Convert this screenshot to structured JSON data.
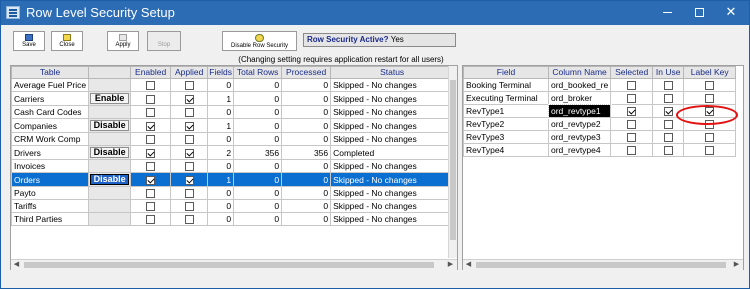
{
  "window": {
    "title": "Row Level Security Setup"
  },
  "toolbar": {
    "save_label": "Save",
    "close_label": "Close",
    "apply_label": "Apply",
    "stop_label": "Stop",
    "disable_label": "Disable Row Security"
  },
  "status": {
    "label": "Row Security Active?",
    "value": "Yes"
  },
  "note": "(Changing setting requires application restart for all users)",
  "left_table": {
    "headers": [
      "Table",
      "",
      "Enabled",
      "Applied",
      "Fields",
      "Total Rows",
      "Processed",
      "Status"
    ],
    "rows": [
      {
        "table": "Average Fuel Price",
        "button": "",
        "enabled": false,
        "applied": false,
        "fields": "0",
        "total_rows": "0",
        "processed": "0",
        "status": "Skipped - No changes"
      },
      {
        "table": "Carriers",
        "button": "Enable",
        "enabled": false,
        "applied": true,
        "fields": "1",
        "total_rows": "0",
        "processed": "0",
        "status": "Skipped - No changes"
      },
      {
        "table": "Cash Card Codes",
        "button": "",
        "enabled": false,
        "applied": false,
        "fields": "0",
        "total_rows": "0",
        "processed": "0",
        "status": "Skipped - No changes"
      },
      {
        "table": "Companies",
        "button": "Disable",
        "enabled": true,
        "applied": true,
        "fields": "1",
        "total_rows": "0",
        "processed": "0",
        "status": "Skipped - No changes"
      },
      {
        "table": "CRM Work Comp",
        "button": "",
        "enabled": false,
        "applied": false,
        "fields": "0",
        "total_rows": "0",
        "processed": "0",
        "status": "Skipped - No changes"
      },
      {
        "table": "Drivers",
        "button": "Disable",
        "enabled": true,
        "applied": true,
        "fields": "2",
        "total_rows": "356",
        "processed": "356",
        "status": "Completed"
      },
      {
        "table": "Invoices",
        "button": "",
        "enabled": false,
        "applied": false,
        "fields": "0",
        "total_rows": "0",
        "processed": "0",
        "status": "Skipped - No changes"
      },
      {
        "table": "Orders",
        "button": "Disable",
        "enabled": true,
        "applied": true,
        "fields": "1",
        "total_rows": "0",
        "processed": "0",
        "status": "Skipped - No changes",
        "selected": true
      },
      {
        "table": "Payto",
        "button": "",
        "enabled": false,
        "applied": false,
        "fields": "0",
        "total_rows": "0",
        "processed": "0",
        "status": "Skipped - No changes"
      },
      {
        "table": "Tariffs",
        "button": "",
        "enabled": false,
        "applied": false,
        "fields": "0",
        "total_rows": "0",
        "processed": "0",
        "status": "Skipped - No changes"
      },
      {
        "table": "Third Parties",
        "button": "",
        "enabled": false,
        "applied": false,
        "fields": "0",
        "total_rows": "0",
        "processed": "0",
        "status": "Skipped - No changes"
      }
    ]
  },
  "right_table": {
    "headers": [
      "Field",
      "Column Name",
      "Selected",
      "In Use",
      "Label Key"
    ],
    "rows": [
      {
        "field": "Booking Terminal",
        "column": "ord_booked_re",
        "selected": false,
        "in_use": false,
        "label_key": false
      },
      {
        "field": "Executing Terminal",
        "column": "ord_broker",
        "selected": false,
        "in_use": false,
        "label_key": false
      },
      {
        "field": "RevType1",
        "column": "ord_revtype1",
        "selected": true,
        "in_use": true,
        "label_key": true,
        "editing": true
      },
      {
        "field": "RevType2",
        "column": "ord_revtype2",
        "selected": false,
        "in_use": false,
        "label_key": false
      },
      {
        "field": "RevType3",
        "column": "ord_revtype3",
        "selected": false,
        "in_use": false,
        "label_key": false
      },
      {
        "field": "RevType4",
        "column": "ord_revtype4",
        "selected": false,
        "in_use": false,
        "label_key": false
      }
    ]
  },
  "colors": {
    "titlebar": "#2b6cb5",
    "selection": "#0a6fd1",
    "header_text": "#1a2d8c",
    "highlight_ring": "#e31212"
  },
  "icons": {
    "app": "table-icon",
    "save": "floppy-disk-icon",
    "close": "folder-close-icon",
    "apply": "apply-icon",
    "disable": "shield-icon"
  }
}
